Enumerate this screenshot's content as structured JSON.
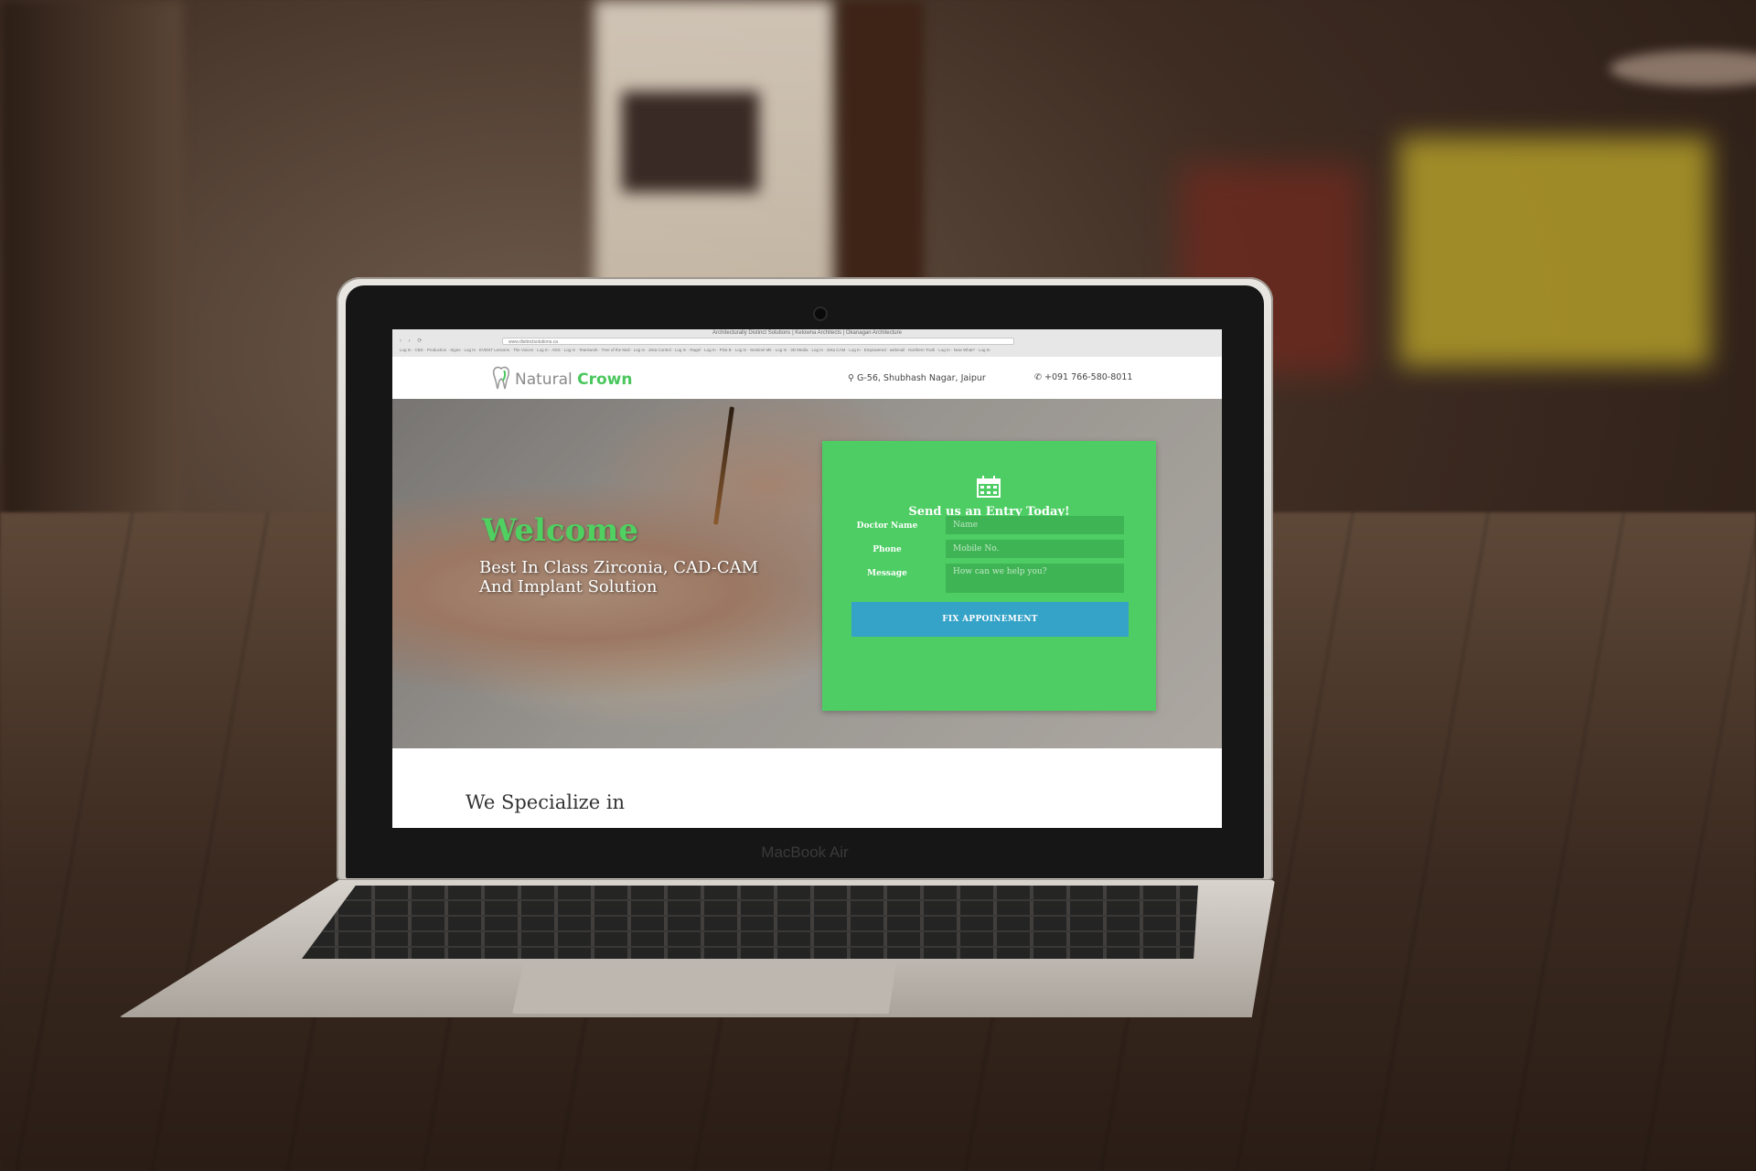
{
  "device": {
    "brand_label": "MacBook Air"
  },
  "browser": {
    "window_title": "Architecturally Distinct Solutions | Kelowna Architects | Okanagan Architecture",
    "url": "www.distinctsolutions.ca",
    "nav_glyphs": "‹ › ⟳",
    "bookmarks": "Log In · CBS · Production · Signs · Log In · EVENT Lessons · The Voices · Log In · ADS · Log In · Teamwork · Tree of the Mail · Log In · Zeta Control · Log In · Ragel · Log In · Pilot B · Log In · Sentinel Mk · Log In · 3D Media · Log In · Zeta CAM · Log In · Empowered · webmail · Northern Truth · Log In · Now What? · Log In"
  },
  "site": {
    "logo": {
      "part1": "Natural",
      "part2": "Crown",
      "icon": "tooth-icon"
    },
    "header": {
      "address": "G-56, Shubhash Nagar, Jaipur",
      "address_icon": "map-marker-icon",
      "phone": "+091 766-580-8011",
      "phone_icon": "phone-icon"
    },
    "hero": {
      "welcome": "Welcome",
      "tagline": "Best In Class Zirconia, CAD-CAM And Implant Solution"
    },
    "form": {
      "icon": "calendar-icon",
      "heading": "Send us an Entry Today!",
      "doctor_label": "Doctor Name",
      "doctor_placeholder": "Name",
      "phone_label": "Phone",
      "phone_placeholder": "Mobile No.",
      "message_label": "Message",
      "message_placeholder": "How can we help you?",
      "button_label": "FIX APPOINEMENT"
    },
    "section": {
      "title": "We Specialize in"
    }
  },
  "colors": {
    "brand_green": "#4dcd63",
    "button_blue": "#35a2c8",
    "logo_gray": "#8a8a8a"
  }
}
